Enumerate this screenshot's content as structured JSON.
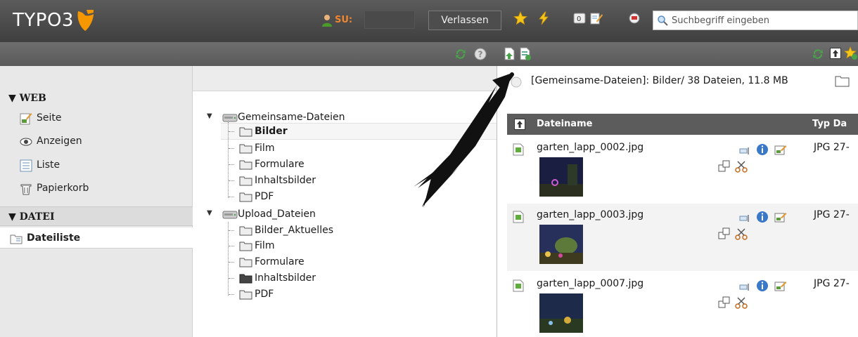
{
  "topbar": {
    "logo": "TYPO3",
    "su_label": "SU:",
    "su_value": "",
    "leave_button": "Verlassen",
    "search_placeholder": "Suchbegriff eingeben",
    "brand_color": "#f49700"
  },
  "module_menu": {
    "sections": [
      {
        "label": "▼ WEB",
        "items": [
          {
            "label": "Seite",
            "icon": "page-edit-icon"
          },
          {
            "label": "Anzeigen",
            "icon": "eye-icon"
          },
          {
            "label": "Liste",
            "icon": "list-icon"
          },
          {
            "label": "Papierkorb",
            "icon": "trash-icon"
          }
        ]
      },
      {
        "label": "▼ DATEI",
        "items": [
          {
            "label": "Dateiliste",
            "icon": "filelist-icon",
            "active": true
          }
        ]
      }
    ]
  },
  "folder_tree": {
    "storages": [
      {
        "label": "Gemeinsame-Dateien",
        "children": [
          "Bilder",
          "Film",
          "Formulare",
          "Inhaltsbilder",
          "PDF"
        ]
      },
      {
        "label": "Upload_Dateien",
        "children": [
          "Bilder_Aktuelles",
          "Film",
          "Formulare",
          "Inhaltsbilder",
          "PDF"
        ]
      }
    ],
    "selected": "Bilder"
  },
  "file_list": {
    "path": "[Gemeinsame-Dateien]: Bilder/ 38 Dateien, 11.8 MB",
    "columns": [
      "Dateiname",
      "Typ",
      "Da"
    ],
    "rows": [
      {
        "name": "garten_lapp_0002.jpg",
        "type": "JPG",
        "date": "27-"
      },
      {
        "name": "garten_lapp_0003.jpg",
        "type": "JPG",
        "date": "27-"
      },
      {
        "name": "garten_lapp_0007.jpg",
        "type": "JPG",
        "date": "27-"
      }
    ]
  }
}
